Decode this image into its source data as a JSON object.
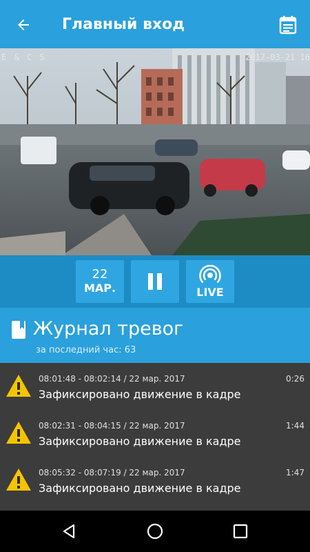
{
  "appbar": {
    "title": "Главный вход",
    "back_icon": "arrow-left-icon",
    "calendar_icon": "calendar-icon",
    "color": "#2aa0dc"
  },
  "camera": {
    "timestamp": "2017-03-21  16",
    "overlay_text": "E & C S"
  },
  "controls": {
    "date_day": "22",
    "date_month": "МАР.",
    "pause_icon": "pause-icon",
    "live_icon": "live-broadcast-icon",
    "live_label": "LIVE"
  },
  "journal": {
    "title": "Журнал тревог",
    "subtitle": "за последний час: 63",
    "icon": "bookmark-icon"
  },
  "alarms": [
    {
      "time": "08:01:48 - 08:02:14 / 22 мар. 2017",
      "duration": "0:26",
      "text": "Зафиксировано движение в кадре",
      "icon": "warning-icon"
    },
    {
      "time": "08:02:31 - 08:04:15 / 22 мар. 2017",
      "duration": "1:44",
      "text": "Зафиксировано движение в кадре",
      "icon": "warning-icon"
    },
    {
      "time": "08:05:32 - 08:07:19 / 22 мар. 2017",
      "duration": "1:47",
      "text": "Зафиксировано движение в кадре",
      "icon": "warning-icon"
    }
  ],
  "navbar": {
    "back_icon": "nav-back-triangle-icon",
    "home_icon": "nav-home-circle-icon",
    "recents_icon": "nav-recents-square-icon"
  },
  "colors": {
    "accent": "#2aa0dc",
    "controls_bg": "#1e8cc4",
    "warning": "#f5c400",
    "list_bg": "#3c3c3c"
  }
}
